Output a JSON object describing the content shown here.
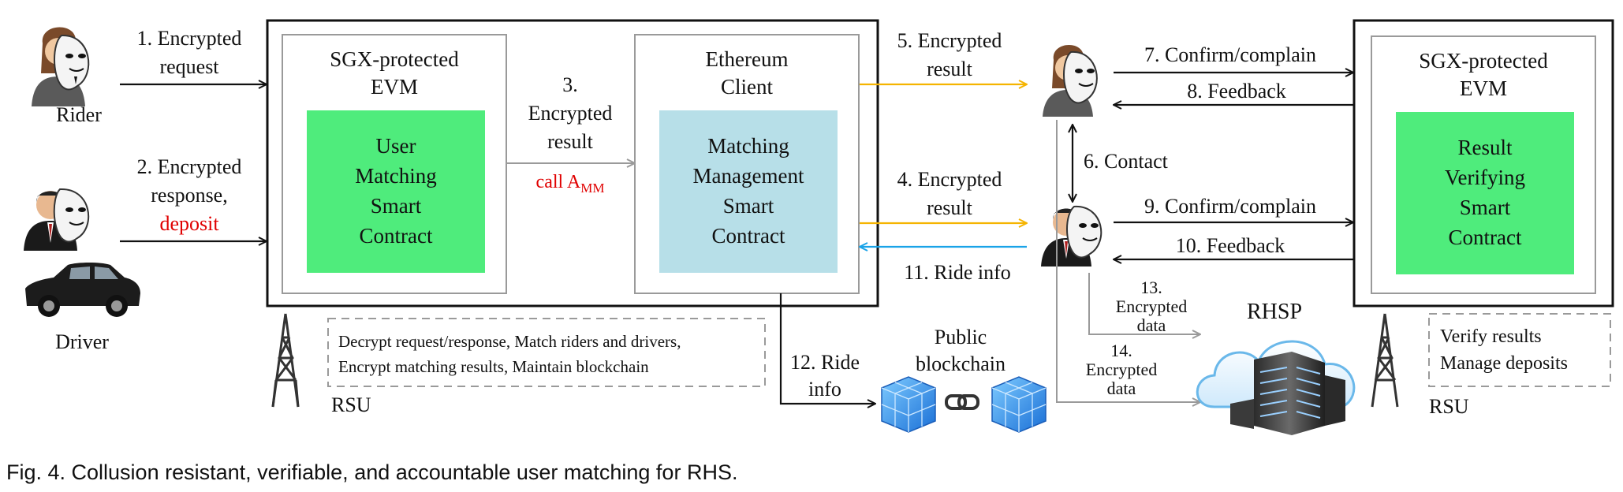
{
  "caption": "Fig. 4. Collusion resistant, verifiable, and accountable user matching for RHS.",
  "actors": {
    "rider": "Rider",
    "driver": "Driver",
    "rsu_left": "RSU",
    "rsu_right": "RSU",
    "rhsp": "RHSP",
    "blockchain": [
      "Public",
      "blockchain"
    ]
  },
  "left_rsu": {
    "evm_title": [
      "SGX-protected",
      "EVM"
    ],
    "user_contract": [
      "User",
      "Matching",
      "Smart",
      "Contract"
    ],
    "eth_title": [
      "Ethereum",
      "Client"
    ],
    "mgmt_contract": [
      "Matching",
      "Management",
      "Smart",
      "Contract"
    ],
    "note": [
      "Decrypt request/response, Match riders and drivers,",
      "Encrypt matching results, Maintain blockchain"
    ]
  },
  "right_rsu": {
    "evm_title": [
      "SGX-protected",
      "EVM"
    ],
    "verify_contract": [
      "Result",
      "Verifying",
      "Smart",
      "Contract"
    ],
    "note": [
      "Verify results",
      "Manage deposits"
    ]
  },
  "flows": {
    "f1": [
      "1. Encrypted",
      "request"
    ],
    "f2": [
      "2. Encrypted",
      "response,"
    ],
    "f2_deposit": "deposit",
    "f3": [
      "3.",
      "Encrypted",
      "result"
    ],
    "f3_call": "call A",
    "f3_call_sub": "MM",
    "f4": [
      "4. Encrypted",
      "result"
    ],
    "f5": [
      "5. Encrypted",
      "result"
    ],
    "f6": "6. Contact",
    "f7": "7. Confirm/complain",
    "f8": "8. Feedback",
    "f9": "9. Confirm/complain",
    "f10": "10. Feedback",
    "f11": "11. Ride info",
    "f12": [
      "12. Ride",
      "info"
    ],
    "f13": [
      "13.",
      "Encrypted",
      "data"
    ],
    "f14": [
      "14.",
      "Encrypted",
      "data"
    ]
  },
  "colors": {
    "user_contract_fill": "#4fec7c",
    "verify_contract_fill": "#4fec7c",
    "mgmt_contract_fill": "#b7dfe8",
    "orange_arrow": "#f5b400",
    "blue_arrow": "#1aa3e8",
    "red_text": "#e00000",
    "gray_line": "#9a9a9a"
  }
}
